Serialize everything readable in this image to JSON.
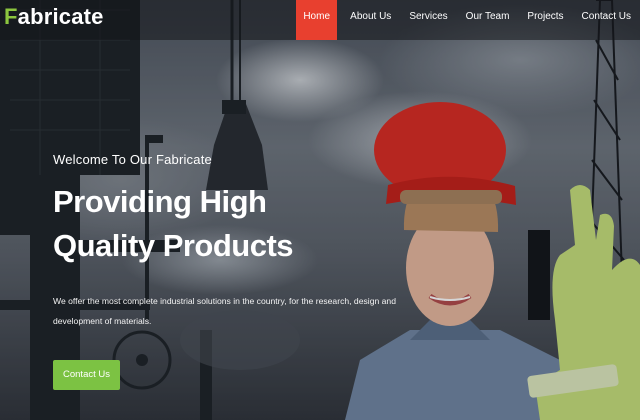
{
  "brand": {
    "first_letter": "F",
    "rest": "abricate"
  },
  "nav": {
    "items": [
      {
        "label": "Home",
        "active": true
      },
      {
        "label": "About Us",
        "active": false
      },
      {
        "label": "Services",
        "active": false
      },
      {
        "label": "Our Team",
        "active": false
      },
      {
        "label": "Projects",
        "active": false
      },
      {
        "label": "Contact Us",
        "active": false
      }
    ]
  },
  "hero": {
    "eyebrow": "Welcome To Our Fabricate",
    "title": "Providing High Quality Products",
    "description": "We offer the most complete industrial solutions in the country, for the research, design and development of materials.",
    "cta_label": "Contact Us",
    "image": "industrial-worker-hard-hat-photo"
  },
  "colors": {
    "accent": "#e8402f",
    "brand_green": "#8cc63f",
    "cta_green": "#7cc243",
    "helmet_red": "#d92a22",
    "glove_green": "#c6e07a"
  }
}
